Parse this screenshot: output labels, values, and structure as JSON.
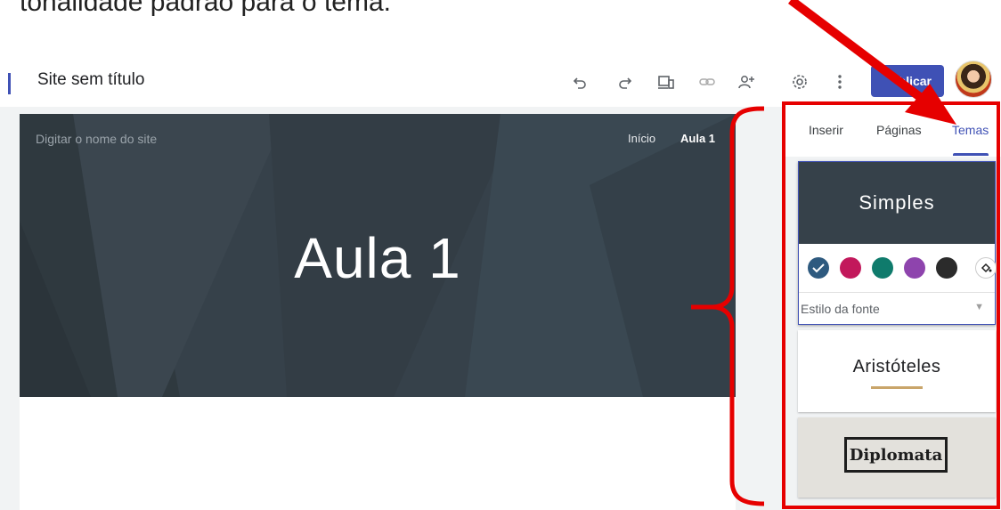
{
  "caption": {
    "text": "tonalidade padrão para o tema."
  },
  "topbar": {
    "site_title": "Site sem título",
    "publish_label": "blicar",
    "icons": [
      "undo-icon",
      "redo-icon",
      "preview-icon",
      "link-icon",
      "share-icon",
      "settings-icon",
      "more-icon"
    ]
  },
  "canvas": {
    "site_name_placeholder": "Digitar o nome do site",
    "nav": [
      "Início",
      "Aula 1"
    ],
    "hero_title": "Aula 1"
  },
  "panel": {
    "tabs": [
      "Inserir",
      "Páginas",
      "Temas"
    ],
    "active_tab": "Temas",
    "themes": {
      "simples": {
        "name": "Simples",
        "colors": [
          "#2e5a7f",
          "#c2185b",
          "#0f7b6c",
          "#8e44ad",
          "#2b2b2b"
        ],
        "selected_color_index": 0,
        "font_style_label": "Estilo da fonte"
      },
      "aristoteles": {
        "name": "Aristóteles"
      },
      "diplomata": {
        "name": "Diplomata"
      }
    }
  },
  "annotation": {
    "highlight_color": "#e60000"
  },
  "colors": {
    "accent": "#3f51b5",
    "hero_background": "#36414a"
  }
}
